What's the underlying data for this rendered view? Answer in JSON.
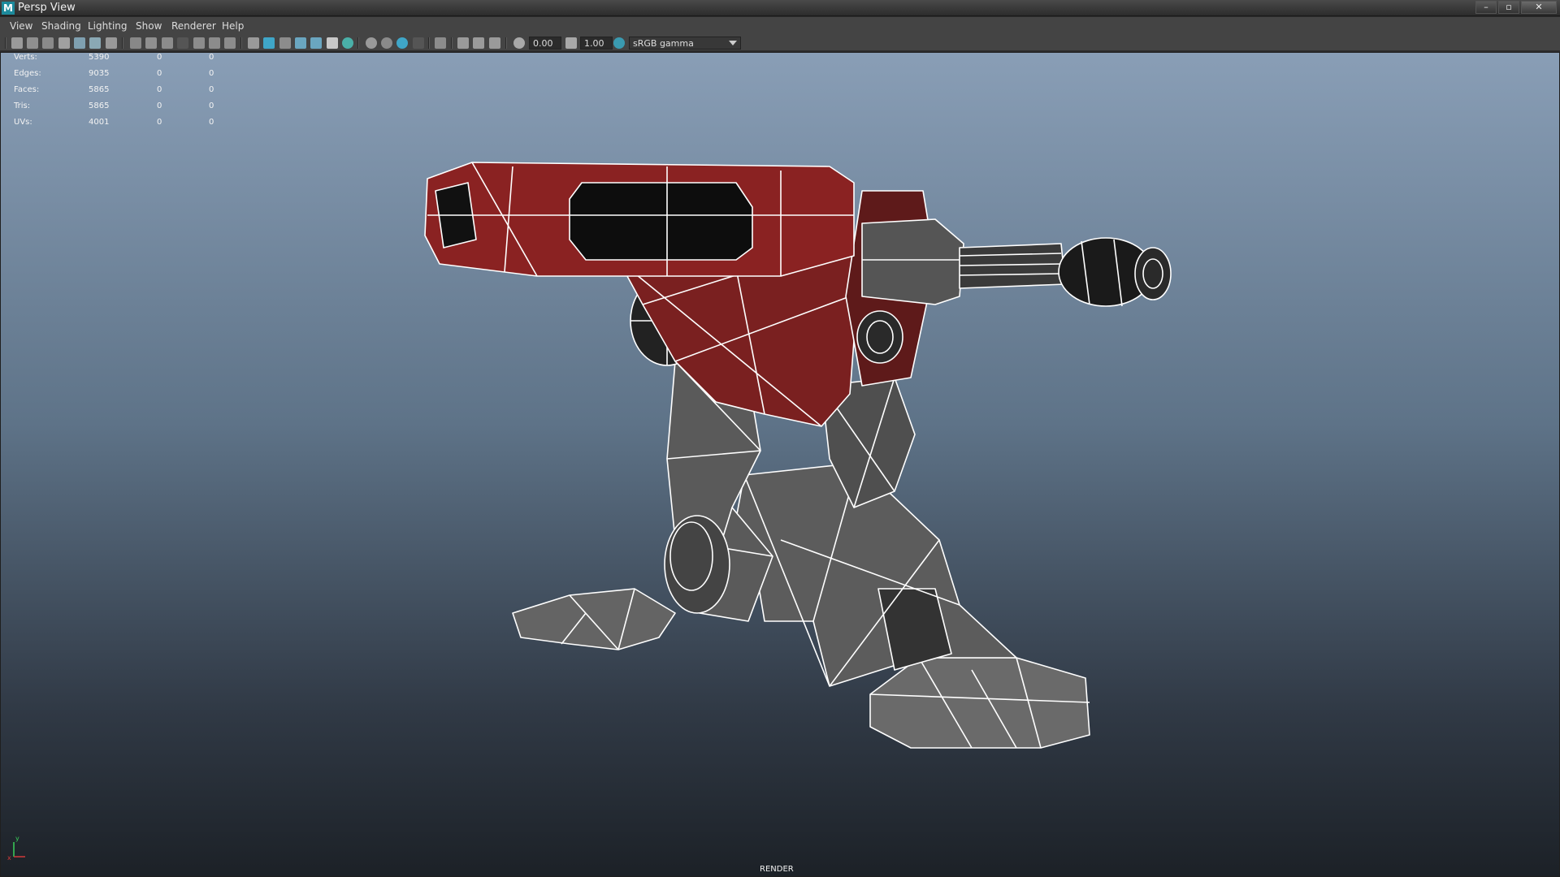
{
  "window": {
    "app_icon_letter": "M",
    "title": "Persp View",
    "minimize": "–",
    "maximize": "▫",
    "close": "✕"
  },
  "menu": {
    "items": [
      "View",
      "Shading",
      "Lighting",
      "Show",
      "Renderer",
      "Help"
    ]
  },
  "toolbar": {
    "exposure_value": "0.00",
    "gamma_value": "1.00",
    "color_space": "sRGB gamma"
  },
  "hud": {
    "rows": [
      {
        "label": "Verts:",
        "c1": "5390",
        "c2": "0",
        "c3": "0"
      },
      {
        "label": "Edges:",
        "c1": "9035",
        "c2": "0",
        "c3": "0"
      },
      {
        "label": "Faces:",
        "c1": "5865",
        "c2": "0",
        "c3": "0"
      },
      {
        "label": "Tris:",
        "c1": "5865",
        "c2": "0",
        "c3": "0"
      },
      {
        "label": "UVs:",
        "c1": "4001",
        "c2": "0",
        "c3": "0"
      }
    ]
  },
  "viewport": {
    "camera_label": "RENDER",
    "axis_y": "y",
    "axis_x": "x"
  },
  "colors": {
    "accent": "#1d8a9c",
    "model_red": "#7a2020",
    "model_dark": "#1a1a1a",
    "model_gray": "#6e6e6e",
    "wire": "#ffffff"
  }
}
